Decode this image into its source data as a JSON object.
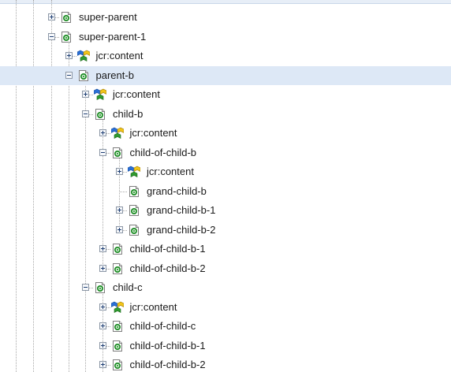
{
  "icons": {
    "page": "page-icon",
    "content": "content-node-icon",
    "toggle_expanded": "collapse-toggle-icon",
    "toggle_collapsed": "expand-toggle-icon"
  },
  "colors": {
    "selection": "#dde8f6",
    "toggle_sign": "#1f3f73",
    "page_icon_accent": "#1a8a22",
    "content_blue": "#2a6fd6",
    "content_green": "#2f9a2f",
    "content_yellow": "#f2c418"
  },
  "tree": {
    "items": [
      {
        "label": "super-parent",
        "depth": 0,
        "toggle": "plus",
        "icon": "page",
        "selected": false
      },
      {
        "label": "super-parent-1",
        "depth": 0,
        "toggle": "minus",
        "icon": "page",
        "selected": false
      },
      {
        "label": "jcr:content",
        "depth": 1,
        "toggle": "plus",
        "icon": "content",
        "selected": false
      },
      {
        "label": "parent-b",
        "depth": 1,
        "toggle": "minus",
        "icon": "page",
        "selected": true
      },
      {
        "label": "jcr:content",
        "depth": 2,
        "toggle": "plus",
        "icon": "content",
        "selected": false
      },
      {
        "label": "child-b",
        "depth": 2,
        "toggle": "minus",
        "icon": "page",
        "selected": false
      },
      {
        "label": "jcr:content",
        "depth": 3,
        "toggle": "plus",
        "icon": "content",
        "selected": false
      },
      {
        "label": "child-of-child-b",
        "depth": 3,
        "toggle": "minus",
        "icon": "page",
        "selected": false
      },
      {
        "label": "jcr:content",
        "depth": 4,
        "toggle": "plus",
        "icon": "content",
        "selected": false
      },
      {
        "label": "grand-child-b",
        "depth": 4,
        "toggle": "none",
        "icon": "page",
        "selected": false
      },
      {
        "label": "grand-child-b-1",
        "depth": 4,
        "toggle": "plus",
        "icon": "page",
        "selected": false
      },
      {
        "label": "grand-child-b-2",
        "depth": 4,
        "toggle": "plus",
        "icon": "page",
        "selected": false
      },
      {
        "label": "child-of-child-b-1",
        "depth": 3,
        "toggle": "plus",
        "icon": "page",
        "selected": false
      },
      {
        "label": "child-of-child-b-2",
        "depth": 3,
        "toggle": "plus",
        "icon": "page",
        "selected": false
      },
      {
        "label": "child-c",
        "depth": 2,
        "toggle": "minus",
        "icon": "page",
        "selected": false
      },
      {
        "label": "jcr:content",
        "depth": 3,
        "toggle": "plus",
        "icon": "content",
        "selected": false
      },
      {
        "label": "child-of-child-c",
        "depth": 3,
        "toggle": "plus",
        "icon": "page",
        "selected": false
      },
      {
        "label": "child-of-child-b-1",
        "depth": 3,
        "toggle": "plus",
        "icon": "page",
        "selected": false
      },
      {
        "label": "child-of-child-b-2",
        "depth": 3,
        "toggle": "plus",
        "icon": "page",
        "selected": false
      }
    ]
  }
}
